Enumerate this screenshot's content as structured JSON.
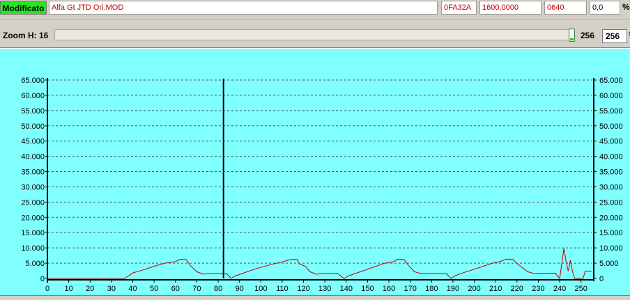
{
  "toolbar": {
    "status": "Modificato",
    "status_color": "#22e81e",
    "file_name": "Alfa Gt JTD Ori.MOD",
    "address": "0FA32A",
    "factor": "1600,0000",
    "hex_value": "0640",
    "percent_value": "0,0",
    "percent_symbol": "%"
  },
  "zoom": {
    "label": "Zoom H: 16",
    "value": 1.0,
    "value_text": "256",
    "input_value": "256"
  },
  "chart_data": {
    "type": "line",
    "xlim": [
      0,
      255
    ],
    "ylim": [
      0,
      65000
    ],
    "x_ticks": [
      0,
      10,
      20,
      30,
      40,
      50,
      60,
      70,
      80,
      90,
      100,
      110,
      120,
      130,
      140,
      150,
      160,
      170,
      180,
      190,
      200,
      210,
      220,
      230,
      240,
      250
    ],
    "y_ticks": [
      "0",
      "5.000",
      "10.000",
      "15.000",
      "20.000",
      "25.000",
      "30.000",
      "35.000",
      "40.000",
      "45.000",
      "50.000",
      "55.000",
      "60.000",
      "65.000"
    ],
    "y_tick_values": [
      0,
      5000,
      10000,
      15000,
      20000,
      25000,
      30000,
      35000,
      40000,
      45000,
      50000,
      55000,
      60000,
      65000
    ],
    "grid": true,
    "line_color": "#c00000",
    "background": "#80ffff",
    "cursor_x": 82.5,
    "series": [
      {
        "points": [
          [
            0,
            0
          ],
          [
            36,
            0
          ],
          [
            38,
            800
          ],
          [
            40,
            1800
          ],
          [
            45,
            2800
          ],
          [
            50,
            4000
          ],
          [
            55,
            5000
          ],
          [
            60,
            5500
          ],
          [
            62,
            6200
          ],
          [
            65,
            6200
          ],
          [
            67,
            4200
          ],
          [
            70,
            2200
          ],
          [
            73,
            1400
          ],
          [
            76,
            1600
          ],
          [
            80,
            1600
          ],
          [
            84,
            1600
          ],
          [
            86,
            0
          ],
          [
            88,
            800
          ],
          [
            92,
            1800
          ],
          [
            97,
            3000
          ],
          [
            101,
            3800
          ],
          [
            105,
            4600
          ],
          [
            110,
            5400
          ],
          [
            112,
            5800
          ],
          [
            114,
            6200
          ],
          [
            117,
            6200
          ],
          [
            118,
            4800
          ],
          [
            121,
            3900
          ],
          [
            123,
            2200
          ],
          [
            126,
            1400
          ],
          [
            130,
            1600
          ],
          [
            136,
            1600
          ],
          [
            139,
            0
          ],
          [
            141,
            800
          ],
          [
            145,
            1800
          ],
          [
            150,
            3000
          ],
          [
            154,
            4000
          ],
          [
            158,
            5000
          ],
          [
            162,
            5400
          ],
          [
            164,
            6200
          ],
          [
            167,
            6200
          ],
          [
            169,
            4400
          ],
          [
            172,
            2200
          ],
          [
            175,
            1600
          ],
          [
            182,
            1600
          ],
          [
            187,
            1600
          ],
          [
            189,
            0
          ],
          [
            191,
            900
          ],
          [
            195,
            1900
          ],
          [
            200,
            3000
          ],
          [
            204,
            3900
          ],
          [
            208,
            4900
          ],
          [
            212,
            5500
          ],
          [
            215,
            6300
          ],
          [
            218,
            6300
          ],
          [
            220,
            4900
          ],
          [
            222,
            3800
          ],
          [
            225,
            2200
          ],
          [
            228,
            1600
          ],
          [
            231,
            1700
          ],
          [
            238,
            1700
          ],
          [
            240,
            0
          ],
          [
            241,
            4800
          ],
          [
            242,
            9900
          ],
          [
            243,
            5600
          ],
          [
            244,
            2400
          ],
          [
            245,
            6000
          ],
          [
            246,
            2400
          ],
          [
            247,
            0
          ],
          [
            251,
            0
          ],
          [
            252,
            2400
          ],
          [
            255,
            2400
          ]
        ]
      }
    ]
  }
}
